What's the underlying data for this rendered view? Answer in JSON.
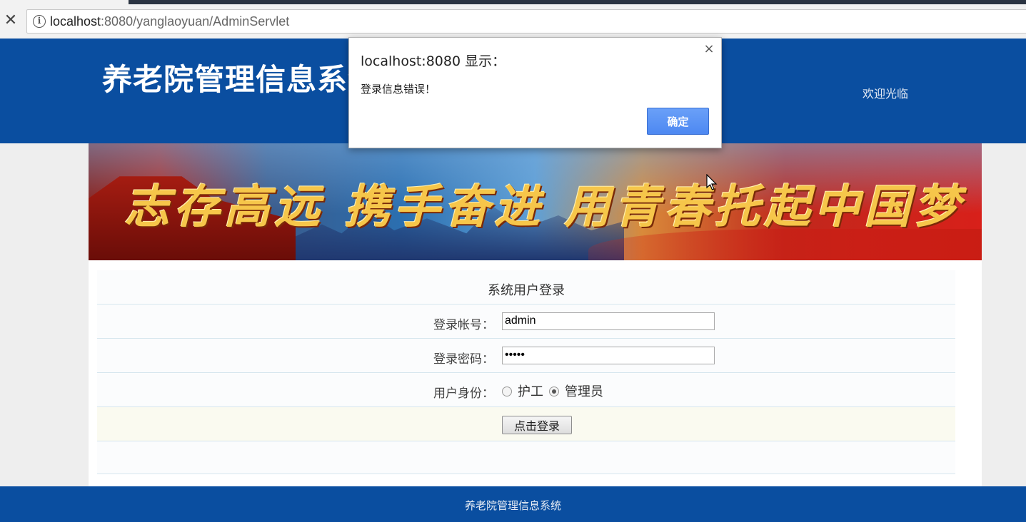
{
  "browser": {
    "url_host": "localhost",
    "url_rest": ":8080/yanglaoyuan/AdminServlet"
  },
  "header": {
    "site_title": "养老院管理信息系统",
    "welcome": "欢迎光临"
  },
  "banner": {
    "slogan": "志存高远 携手奋进 用青春托起中国梦"
  },
  "login": {
    "title": "系统用户登录",
    "account_label": "登录帐号：",
    "account_value": "admin",
    "password_label": "登录密码：",
    "password_value": "•••••",
    "role_label": "用户身份：",
    "role_options": [
      "护工",
      "管理员"
    ],
    "role_selected": "管理员",
    "submit_label": "点击登录"
  },
  "footer": {
    "text": "养老院管理信息系统"
  },
  "dialog": {
    "title": "localhost:8080 显示：",
    "message": "登录信息错误！",
    "ok_label": "确定"
  },
  "colors": {
    "header_blue": "#0a4ea0",
    "ok_button_blue": "#4d88f2"
  }
}
